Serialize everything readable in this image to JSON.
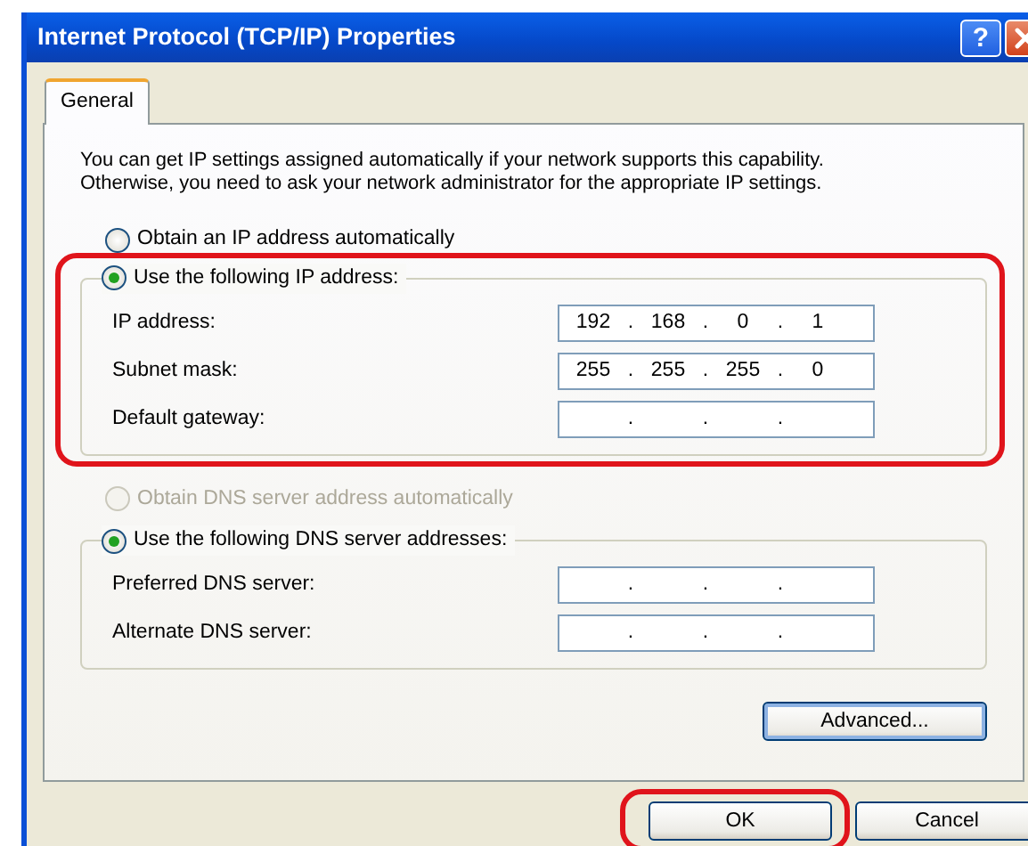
{
  "window": {
    "title": "Internet Protocol (TCP/IP) Properties",
    "controls": [
      {
        "kind": "help",
        "label": "?"
      },
      {
        "kind": "close"
      }
    ]
  },
  "tabs": [
    {
      "label": "General",
      "selected": true
    }
  ],
  "intro": "You can get IP settings assigned automatically if your network supports this capability. Otherwise, you need to ask your network administrator for the appropriate IP settings.",
  "ip_auto": {
    "label": "Obtain an IP address automatically",
    "selected": false,
    "disabled": false
  },
  "ip_group": {
    "label": "Use the following IP address:",
    "selected": true,
    "highlighted": true,
    "fields": [
      {
        "label": "IP address:",
        "octets": [
          "192",
          "168",
          "0",
          "1"
        ],
        "separators": [
          ".",
          ".",
          "."
        ]
      },
      {
        "label": "Subnet mask:",
        "octets": [
          "255",
          "255",
          "255",
          "0"
        ],
        "separators": [
          ".",
          ".",
          "."
        ]
      },
      {
        "label": "Default gateway:",
        "separators": [
          ".",
          ".",
          "."
        ]
      }
    ]
  },
  "dns_auto": {
    "label": "Obtain DNS server address automatically",
    "selected": false,
    "disabled": true
  },
  "dns_group": {
    "label": "Use the following DNS server addresses:",
    "selected": true,
    "highlighted": false,
    "fields": [
      {
        "label": "Preferred DNS server:",
        "separators": [
          ".",
          ".",
          "."
        ]
      },
      {
        "label": "Alternate DNS server:",
        "separators": [
          ".",
          ".",
          "."
        ]
      }
    ]
  },
  "advanced_button": {
    "label": "Advanced...",
    "focused": true
  },
  "buttons": [
    {
      "label": "OK",
      "highlighted": true
    },
    {
      "label": "Cancel",
      "highlighted": false
    }
  ]
}
